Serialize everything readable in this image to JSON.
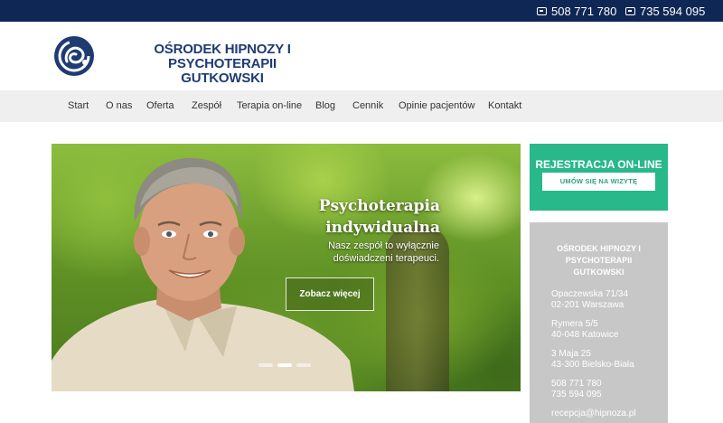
{
  "topbar": {
    "phone1": "508 771 780",
    "phone2": "735 594 095",
    "phone_icon": "phone-icon",
    "bg_color": "#0e2755"
  },
  "header": {
    "logo_icon": "spiral-logo-icon",
    "brand_line1": "OŚRODEK HIPNOZY I PSYCHOTERAPII",
    "brand_line2": "GUTKOWSKI",
    "brand_color": "#1f3b73"
  },
  "nav": {
    "items": [
      "Start",
      "O nas",
      "Oferta",
      "Zespół",
      "Terapia on-line",
      "Blog",
      "Cennik",
      "Opinie pacjentów",
      "Kontakt"
    ]
  },
  "slider": {
    "title_line1": "Psychoterapia",
    "title_line2": "indywidualna",
    "subtitle_line1": "Nasz zespół to wyłącznie",
    "subtitle_line2": "doświadczeni terapeuci.",
    "button": "Zobacz więcej",
    "slide_count": 3,
    "active_slide": 2
  },
  "registration": {
    "title": "REJESTRACJA ON-LINE",
    "button": "UMÓW SIĘ NA WIZYTĘ",
    "color": "#28b889"
  },
  "contact": {
    "title_line1": "OŚRODEK HIPNOZY I",
    "title_line2": "PSYCHOTERAPII",
    "title_line3": "GUTKOWSKI",
    "addr1_street": "Opaczewska 71/34",
    "addr1_city": "02-201 Warszawa",
    "addr2_street": "Rymera 5/5",
    "addr2_city": "40-048 Katowice",
    "addr3_street": "3 Maja 25",
    "addr3_city": "43-300 Bielsko-Biała",
    "phone1": "508 771 780",
    "phone2": "735 594 095",
    "email": "recepcja@hipnoza.pl",
    "bg_color": "#c7c7c7"
  }
}
